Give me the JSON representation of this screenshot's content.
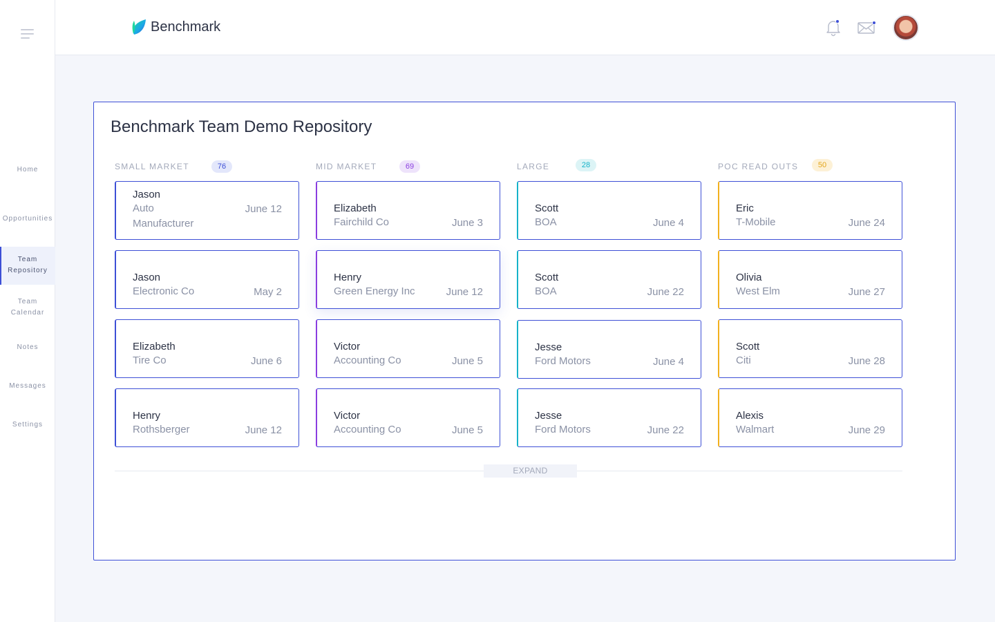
{
  "app": {
    "name": "Benchmark"
  },
  "sidebar": {
    "items": [
      {
        "label": "Home"
      },
      {
        "label": "Opportunities"
      },
      {
        "label": "Team Repository"
      },
      {
        "label": "Team Calendar"
      },
      {
        "label": "Notes"
      },
      {
        "label": "Messages"
      },
      {
        "label": "Settings"
      }
    ],
    "active": "Team Repository"
  },
  "header": {
    "icons": [
      "bell-icon",
      "mail-icon",
      "avatar"
    ]
  },
  "colors": {
    "accent": "#3d4fd6",
    "small_market": "#3d4fd6",
    "mid_market": "#8a3ee0",
    "large": "#16b3c9",
    "poc": "#f2b01e"
  },
  "main": {
    "title": "Benchmark Team Demo Repository",
    "expand_label": "EXPAND",
    "columns": [
      {
        "title": "SMALL MARKET",
        "count": "76",
        "cards": [
          {
            "name": "Jason",
            "company": "Auto Manufacturer",
            "date": "June 12"
          },
          {
            "name": "Jason",
            "company": "Electronic Co",
            "date": "May 2"
          },
          {
            "name": "Elizabeth",
            "company": "Tire Co",
            "date": "June 6"
          },
          {
            "name": "Henry",
            "company": "Rothsberger",
            "date": "June 12"
          }
        ]
      },
      {
        "title": "MID MARKET",
        "count": "69",
        "cards": [
          {
            "name": "Elizabeth",
            "company": "Fairchild Co",
            "date": "June 3"
          },
          {
            "name": "Henry",
            "company": "Green Energy Inc",
            "date": "June 12"
          },
          {
            "name": "Victor",
            "company": "Accounting Co",
            "date": "June 5"
          },
          {
            "name": "Victor",
            "company": "Accounting Co",
            "date": "June 5"
          }
        ]
      },
      {
        "title": "LARGE",
        "count": "28",
        "cards": [
          {
            "name": "Scott",
            "company": "BOA",
            "date": "June 4"
          },
          {
            "name": "Scott",
            "company": "BOA",
            "date": "June 22"
          },
          {
            "name": "Jesse",
            "company": "Ford Motors",
            "date": "June 4"
          },
          {
            "name": "Jesse",
            "company": "Ford Motors",
            "date": "June 22"
          }
        ]
      },
      {
        "title": "POC READ OUTS",
        "count": "50",
        "cards": [
          {
            "name": "Eric",
            "company": "T-Mobile",
            "date": "June 24"
          },
          {
            "name": "Olivia",
            "company": "West Elm",
            "date": "June 27"
          },
          {
            "name": "Scott",
            "company": "Citi",
            "date": "June 28"
          },
          {
            "name": "Alexis",
            "company": "Walmart",
            "date": "June 29"
          }
        ]
      }
    ]
  }
}
